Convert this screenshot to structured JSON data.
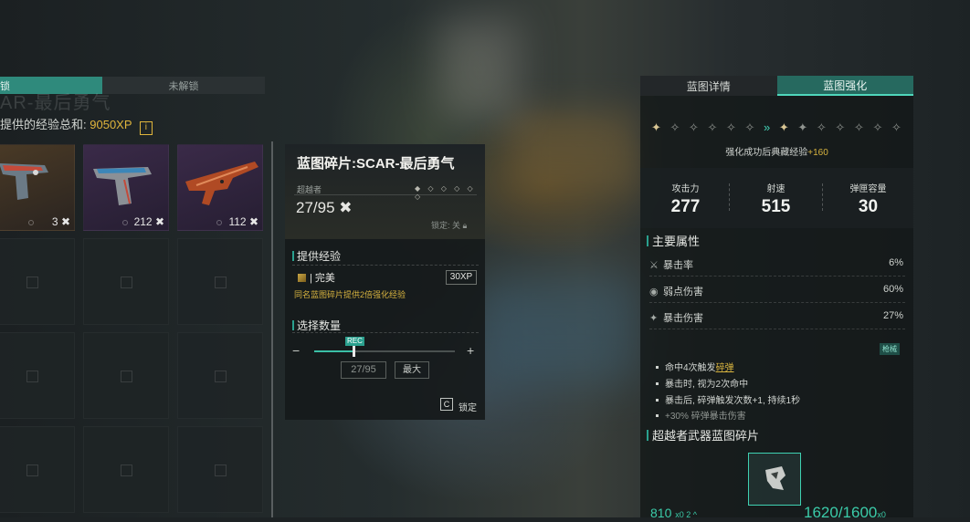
{
  "left": {
    "tabs": {
      "unlocked": "锁",
      "locked": "未解锁"
    },
    "ghost_title": "AR-最后勇气",
    "xp_sum_label": "提供的经验总和:",
    "xp_sum_value": "9050XP",
    "info_icon": "i",
    "cards": [
      {
        "count": "3",
        "icon": "pistol-icon"
      },
      {
        "count": "212",
        "icon": "pistol-icon"
      },
      {
        "count": "112",
        "icon": "rifle-icon"
      }
    ]
  },
  "tooltip": {
    "title": "蓝图碎片:SCAR-最后勇气",
    "rarity": "超越者",
    "rarity_dots": "◆ ◇ ◇ ◇ ◇ ◇",
    "count": "27/95",
    "lock_status": "锁定: 关",
    "provide_xp_title": "提供经验",
    "quality": "完美",
    "quality_xp": "30XP",
    "note": "同名蓝图碎片提供2倍强化经验",
    "select_qty_title": "选择数量",
    "rec_label": "REC",
    "minus": "−",
    "plus": "+",
    "qty_value": "27/95",
    "max_label": "最大",
    "lock_key": "C",
    "lock_label": "锁定",
    "slider_fraction": 0.28
  },
  "right": {
    "tabs": {
      "detail": "蓝图详情",
      "enhance": "蓝图强化"
    },
    "enhance_note": "强化成功后典藏经验",
    "enhance_bonus": "+160",
    "stats": [
      {
        "label": "攻击力",
        "value": "277"
      },
      {
        "label": "射速",
        "value": "515"
      },
      {
        "label": "弹匣容量",
        "value": "30"
      }
    ],
    "main_attr_title": "主要属性",
    "attrs": [
      {
        "icon": "⚔",
        "label": "暴击率",
        "value": "6%"
      },
      {
        "icon": "◉",
        "label": "弱点伤害",
        "value": "60%"
      },
      {
        "icon": "✦",
        "label": "暴击伤害",
        "value": "27%"
      }
    ],
    "tag": "枪械",
    "perks": [
      {
        "pre": "命中4次触发",
        "hl": "碎弹",
        "post": ""
      },
      {
        "pre": "暴击时, 视为2次命中",
        "hl": "",
        "post": ""
      },
      {
        "pre": "暴击后, 碎弹触发次数+1, 持续1秒",
        "hl": "",
        "post": ""
      },
      {
        "pre": "+30% 碎弹暴击伤害",
        "hl": "",
        "post": ""
      }
    ],
    "fragments_title": "超越者武器蓝图碎片",
    "bottom_left": "810",
    "bottom_left_unit": "x0 2 ^",
    "bottom_right": "1620/1600",
    "bottom_right_unit": "x0"
  }
}
